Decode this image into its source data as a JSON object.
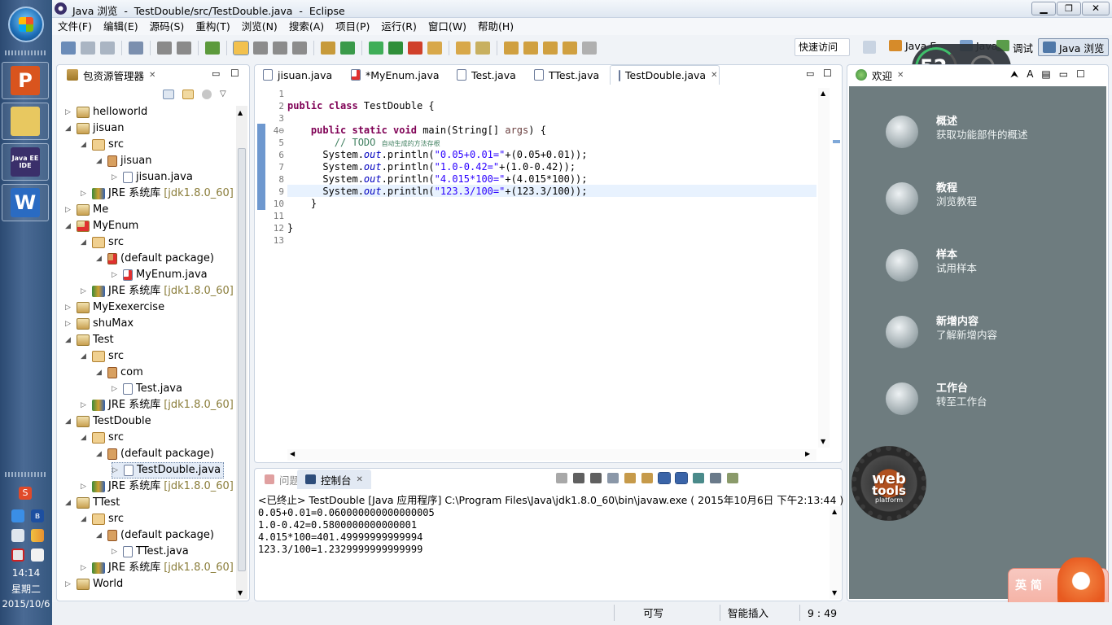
{
  "taskbar": {
    "time": "14:14",
    "weekday": "星期二",
    "date": "2015/10/6",
    "apps": [
      {
        "name": "ppt-icon",
        "glyph": "P",
        "bg": "#d9541e"
      },
      {
        "name": "file-explorer-icon",
        "glyph": "",
        "bg": "#e8c860"
      },
      {
        "name": "eclipse-javaee-icon",
        "glyph": "Java EE IDE",
        "bg": "#3a2f6a"
      },
      {
        "name": "wps-writer-icon",
        "glyph": "W",
        "bg": "#2a6bc2"
      }
    ]
  },
  "window": {
    "title": "Java 浏览  -  TestDouble/src/TestDouble.java  -  Eclipse"
  },
  "menu": [
    "文件(F)",
    "编辑(E)",
    "源码(S)",
    "重构(T)",
    "浏览(N)",
    "搜索(A)",
    "项目(P)",
    "运行(R)",
    "窗口(W)",
    "帮助(H)"
  ],
  "quick_access": "快速访问",
  "perspectives": {
    "javaee": "Java E",
    "java": "Java",
    "debug": "调试",
    "browse": "Java 浏览"
  },
  "overlay": {
    "percent": "52",
    "unit": "%"
  },
  "package_explorer": {
    "title": "包资源管理器",
    "rows": [
      {
        "d": 0,
        "tw": "▷",
        "icon": "proj",
        "label": "helloworld"
      },
      {
        "d": 0,
        "tw": "◢",
        "icon": "proj",
        "label": "jisuan"
      },
      {
        "d": 1,
        "tw": "◢",
        "icon": "src",
        "label": "src"
      },
      {
        "d": 2,
        "tw": "◢",
        "icon": "pkg",
        "label": "jisuan"
      },
      {
        "d": 3,
        "tw": "▷",
        "icon": "java",
        "label": "jisuan.java"
      },
      {
        "d": 1,
        "tw": "▷",
        "icon": "jre",
        "label": "JRE 系统库",
        "extra": "[jdk1.8.0_60]"
      },
      {
        "d": 0,
        "tw": "▷",
        "icon": "proj",
        "label": "Me"
      },
      {
        "d": 0,
        "tw": "◢",
        "icon": "projerr",
        "label": "MyEnum"
      },
      {
        "d": 1,
        "tw": "◢",
        "icon": "src",
        "label": "src"
      },
      {
        "d": 2,
        "tw": "◢",
        "icon": "pkgerr",
        "label": "(default package)"
      },
      {
        "d": 3,
        "tw": "▷",
        "icon": "javaerr",
        "label": "MyEnum.java"
      },
      {
        "d": 1,
        "tw": "▷",
        "icon": "jre",
        "label": "JRE 系统库",
        "extra": "[jdk1.8.0_60]"
      },
      {
        "d": 0,
        "tw": "▷",
        "icon": "proj",
        "label": "MyExexercise"
      },
      {
        "d": 0,
        "tw": "▷",
        "icon": "proj",
        "label": "shuMax"
      },
      {
        "d": 0,
        "tw": "◢",
        "icon": "proj",
        "label": "Test"
      },
      {
        "d": 1,
        "tw": "◢",
        "icon": "src",
        "label": "src"
      },
      {
        "d": 2,
        "tw": "◢",
        "icon": "pkg",
        "label": "com"
      },
      {
        "d": 3,
        "tw": "▷",
        "icon": "java",
        "label": "Test.java"
      },
      {
        "d": 1,
        "tw": "▷",
        "icon": "jre",
        "label": "JRE 系统库",
        "extra": "[jdk1.8.0_60]"
      },
      {
        "d": 0,
        "tw": "◢",
        "icon": "proj",
        "label": "TestDouble"
      },
      {
        "d": 1,
        "tw": "◢",
        "icon": "src",
        "label": "src"
      },
      {
        "d": 2,
        "tw": "◢",
        "icon": "pkg",
        "label": "(default package)"
      },
      {
        "d": 3,
        "tw": "▷",
        "icon": "java",
        "label": "TestDouble.java",
        "selected": true
      },
      {
        "d": 1,
        "tw": "▷",
        "icon": "jre",
        "label": "JRE 系统库",
        "extra": "[jdk1.8.0_60]"
      },
      {
        "d": 0,
        "tw": "◢",
        "icon": "proj",
        "label": "TTest"
      },
      {
        "d": 1,
        "tw": "◢",
        "icon": "src",
        "label": "src"
      },
      {
        "d": 2,
        "tw": "◢",
        "icon": "pkg",
        "label": "(default package)"
      },
      {
        "d": 3,
        "tw": "▷",
        "icon": "java",
        "label": "TTest.java"
      },
      {
        "d": 1,
        "tw": "▷",
        "icon": "jre",
        "label": "JRE 系统库",
        "extra": "[jdk1.8.0_60]"
      },
      {
        "d": 0,
        "tw": "▷",
        "icon": "proj",
        "label": "World"
      }
    ]
  },
  "editor": {
    "tabs": [
      {
        "label": "jisuan.java",
        "icon": "java",
        "active": false
      },
      {
        "label": "*MyEnum.java",
        "icon": "javaerr",
        "active": false
      },
      {
        "label": "Test.java",
        "icon": "java",
        "active": false
      },
      {
        "label": "TTest.java",
        "icon": "java",
        "active": false
      },
      {
        "label": "TestDouble.java",
        "icon": "java",
        "active": true,
        "close": "✕"
      }
    ],
    "lines": [
      {
        "n": "1",
        "t": []
      },
      {
        "n": "2",
        "t": [
          [
            "kw",
            "public class "
          ],
          [
            "",
            "TestDouble {"
          ]
        ]
      },
      {
        "n": "3",
        "t": []
      },
      {
        "n": "4⊖",
        "t": [
          [
            "",
            "    "
          ],
          [
            "kw",
            "public static void "
          ],
          [
            "",
            "main(String[] "
          ],
          [
            "fld2",
            "args"
          ],
          [
            "",
            ") {"
          ]
        ]
      },
      {
        "n": "5",
        "t": [
          [
            "",
            "        "
          ],
          [
            "cm",
            "// TODO "
          ],
          [
            "cm",
            "自动生成的方法存根"
          ]
        ]
      },
      {
        "n": "6",
        "t": [
          [
            "",
            "      System."
          ],
          [
            "fld",
            "out"
          ],
          [
            "",
            ".println("
          ],
          [
            "st",
            "\"0.05+0.01=\""
          ],
          [
            "",
            "+(0.05+0.01));"
          ]
        ]
      },
      {
        "n": "7",
        "t": [
          [
            "",
            "      System."
          ],
          [
            "fld",
            "out"
          ],
          [
            "",
            ".println("
          ],
          [
            "st",
            "\"1.0-0.42=\""
          ],
          [
            "",
            "+(1.0-0.42));"
          ]
        ]
      },
      {
        "n": "8",
        "t": [
          [
            "",
            "      System."
          ],
          [
            "fld",
            "out"
          ],
          [
            "",
            ".println("
          ],
          [
            "st",
            "\"4.015*100=\""
          ],
          [
            "",
            "+(4.015*100));"
          ]
        ]
      },
      {
        "n": "9",
        "t": [
          [
            "",
            "      System."
          ],
          [
            "fld",
            "out"
          ],
          [
            "",
            ".println("
          ],
          [
            "st",
            "\"123.3/100=\""
          ],
          [
            "",
            "+(123.3/100));"
          ]
        ],
        "cur": true
      },
      {
        "n": "10",
        "t": [
          [
            "",
            "    }"
          ]
        ]
      },
      {
        "n": "11",
        "t": []
      },
      {
        "n": "12",
        "t": [
          [
            "",
            "}"
          ]
        ]
      },
      {
        "n": "13",
        "t": []
      }
    ]
  },
  "console": {
    "tab_problems": "问题",
    "tab_console": "控制台",
    "header": "<已终止> TestDouble [Java 应用程序] C:\\Program Files\\Java\\jdk1.8.0_60\\bin\\javaw.exe ( 2015年10月6日 下午2:13:44 )",
    "output": [
      "0.05+0.01=0.060000000000000005",
      "1.0-0.42=0.5800000000000001",
      "4.015*100=401.49999999999994",
      "123.3/100=1.2329999999999999"
    ]
  },
  "welcome": {
    "tab": "欢迎",
    "items": [
      {
        "title": "概述",
        "sub": "获取功能部件的概述",
        "icon": "globe-icon"
      },
      {
        "title": "教程",
        "sub": "浏览教程",
        "icon": "tutorial-icon"
      },
      {
        "title": "样本",
        "sub": "试用样本",
        "icon": "samples-icon"
      },
      {
        "title": "新增内容",
        "sub": "了解新增内容",
        "icon": "whats-new-icon"
      },
      {
        "title": "工作台",
        "sub": "转至工作台",
        "icon": "workbench-icon"
      }
    ]
  },
  "webtools": {
    "line1": "web",
    "line2": "tools",
    "line3": "platform"
  },
  "ime": {
    "label": "英 简"
  },
  "status": {
    "writable": "可写",
    "insert": "智能插入",
    "position": "9 : 49"
  }
}
